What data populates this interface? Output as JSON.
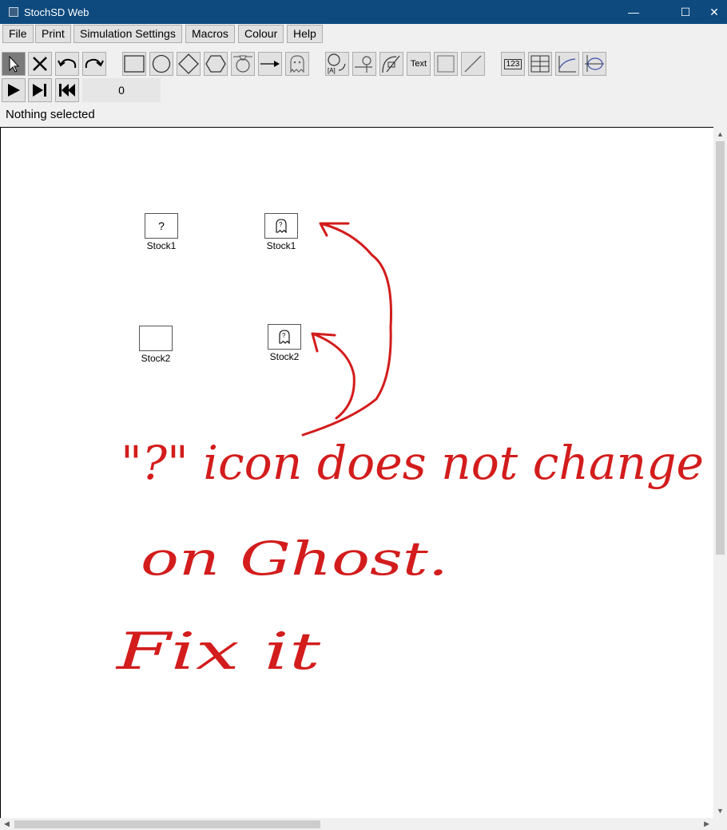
{
  "window": {
    "title": "StochSD Web",
    "minimize": "—",
    "maximize": "☐",
    "close": "✕"
  },
  "menu": [
    "File",
    "Print",
    "Simulation Settings",
    "Macros",
    "Colour",
    "Help"
  ],
  "toolbar": {
    "text_tool_label": "Text",
    "number_tool_label": "123",
    "time_value": "0"
  },
  "status": "Nothing selected",
  "stocks": [
    {
      "label": "Stock1",
      "icon": "?"
    },
    {
      "label": "Stock1",
      "icon": "ghost-icon"
    },
    {
      "label": "Stock2",
      "icon": ""
    },
    {
      "label": "Stock2",
      "icon": "ghost-icon"
    }
  ],
  "annotation": {
    "color": "#d31c1c",
    "lines": [
      "\"?\" icon does not change",
      "on Ghost.",
      "Fix it"
    ]
  },
  "colors": {
    "titlebar": "#0e4a7e",
    "annotation": "#d31c1c"
  }
}
